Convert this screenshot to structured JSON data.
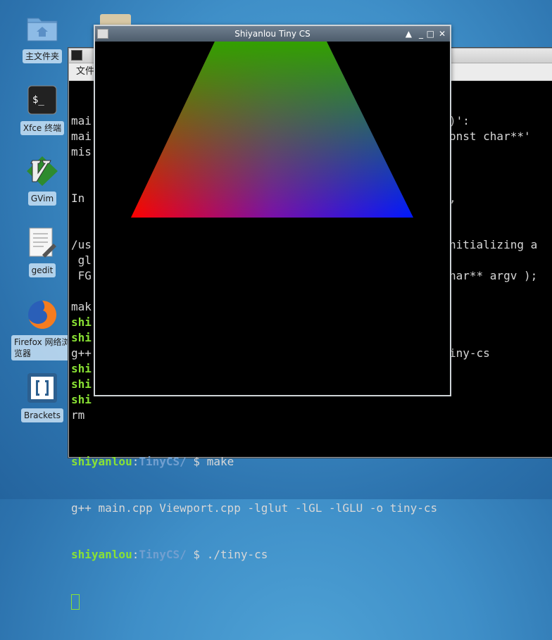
{
  "desktop": {
    "icons": [
      {
        "label": "主文件夹",
        "icon": "folder-icon"
      },
      {
        "label": "Xfce 终端",
        "icon": "terminal-icon"
      },
      {
        "label": "GVim",
        "icon": "vim-icon"
      },
      {
        "label": "gedit",
        "icon": "text-editor-icon"
      },
      {
        "label": "Firefox 网络浏览器",
        "icon": "firefox-icon"
      },
      {
        "label": "Brackets",
        "icon": "brackets-icon"
      }
    ]
  },
  "terminal": {
    "menu_label": "文件",
    "partial_lines": [
      {
        "left": "mai",
        "right": ")':"
      },
      {
        "left": "mai",
        "right": "onst char**' "
      },
      {
        "left": "mis",
        "right": ""
      },
      {
        "left": "",
        "right": ""
      },
      {
        "left": "",
        "right": ""
      },
      {
        "left": "In ",
        "right": ","
      },
      {
        "left": "",
        "right": ""
      },
      {
        "left": "",
        "right": ""
      },
      {
        "left": "/us",
        "right": "nitializing a"
      },
      {
        "left": " gl",
        "right": ""
      },
      {
        "left": " FG",
        "right": "har** argv );"
      },
      {
        "left": "",
        "right": ""
      },
      {
        "left": "mak",
        "right": ""
      },
      {
        "left": "shi",
        "right": "",
        "green": true
      },
      {
        "left": "shi",
        "right": "",
        "green": true
      },
      {
        "left": "g++",
        "right": "iny-cs"
      },
      {
        "left": "shi",
        "right": "",
        "green": true
      },
      {
        "left": "shi",
        "right": "",
        "green": true
      },
      {
        "left": "shi",
        "right": "",
        "green": true
      },
      {
        "left": "rm ",
        "right": ""
      }
    ],
    "prompt_user": "shiyanlou",
    "prompt_sep": ":",
    "prompt_path": "TinyCS/",
    "prompt_symbol": " $ ",
    "cmd1": "make",
    "output1": "g++ main.cpp Viewport.cpp -lglut -lGL -lGLU -o tiny-cs",
    "cmd2": "./tiny-cs"
  },
  "gl_window": {
    "title": "Shiyanlou Tiny CS",
    "controls": [
      "▲",
      "_",
      "□",
      "✕"
    ]
  }
}
